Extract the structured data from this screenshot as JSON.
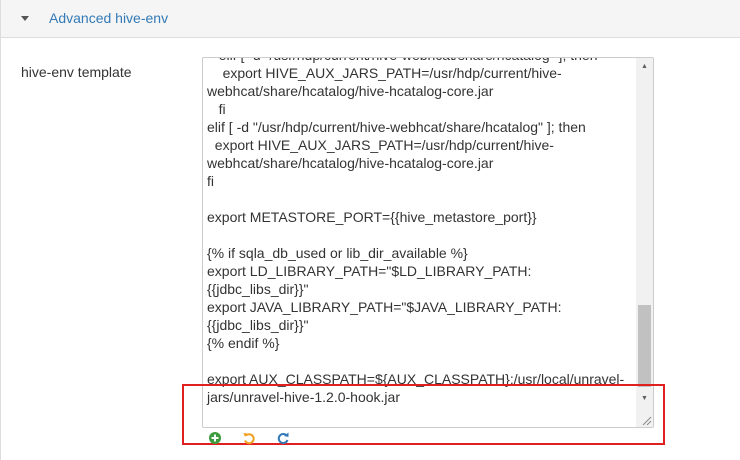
{
  "panel": {
    "title": "Advanced hive-env"
  },
  "field": {
    "label": "hive-env template",
    "value": "   elif [ -d \"/usr/hdp/current/hive-webhcat/share/hcatalog\" ]; then\n    export HIVE_AUX_JARS_PATH=/usr/hdp/current/hive-\nwebhcat/share/hcatalog/hive-hcatalog-core.jar\n   fi\nelif [ -d \"/usr/hdp/current/hive-webhcat/share/hcatalog\" ]; then\n  export HIVE_AUX_JARS_PATH=/usr/hdp/current/hive-\nwebhcat/share/hcatalog/hive-hcatalog-core.jar\nfi\n\nexport METASTORE_PORT={{hive_metastore_port}}\n\n{% if sqla_db_used or lib_dir_available %}\nexport LD_LIBRARY_PATH=\"$LD_LIBRARY_PATH:\n{{jdbc_libs_dir}}\"\nexport JAVA_LIBRARY_PATH=\"$JAVA_LIBRARY_PATH:\n{{jdbc_libs_dir}}\"\n{% endif %}\n\nexport AUX_CLASSPATH=${AUX_CLASSPATH}:/usr/local/unravel-\njars/unravel-hive-1.2.0-hook.jar"
  },
  "icons": {
    "header": "caret-down-icon",
    "actions": [
      "plus-circle-icon",
      "undo-icon",
      "refresh-icon"
    ]
  },
  "colors": {
    "link": "#337ab7",
    "highlight": "#e02020",
    "add": "#3c9b3c",
    "undo": "#f0a020",
    "refresh": "#337ab7"
  }
}
